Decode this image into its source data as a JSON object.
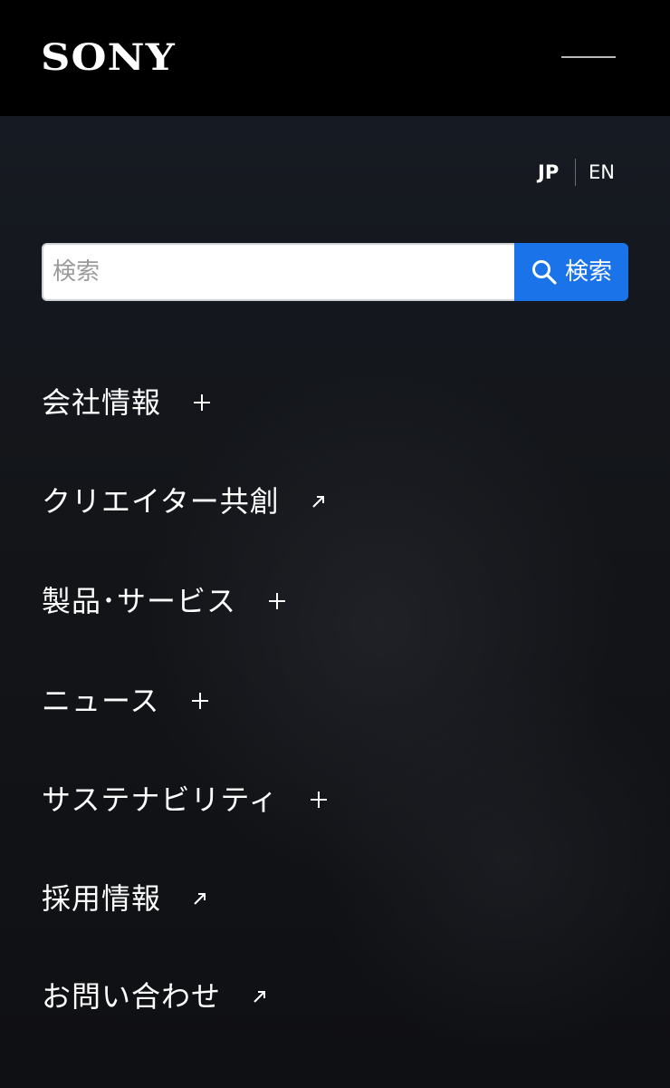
{
  "header": {
    "logo_text": "SONY",
    "menu_icon": "menu-close-line-icon"
  },
  "language": {
    "jp_label": "JP",
    "en_label": "EN",
    "selected": "JP"
  },
  "search": {
    "placeholder": "検索",
    "value": "",
    "button_label": "検索",
    "button_icon": "search-icon",
    "button_color": "#1a73e8"
  },
  "nav": {
    "items": [
      {
        "label": "会社情報",
        "icon": "plus-icon"
      },
      {
        "label": "クリエイター共創",
        "icon": "external-arrow-icon"
      },
      {
        "label": "製品･サービス",
        "icon": "plus-icon"
      },
      {
        "label": "ニュース",
        "icon": "plus-icon"
      },
      {
        "label": "サステナビリティ",
        "icon": "plus-icon"
      },
      {
        "label": "採用情報",
        "icon": "external-arrow-icon"
      },
      {
        "label": "お問い合わせ",
        "icon": "external-arrow-icon"
      }
    ]
  },
  "colors": {
    "header_bg": "#000000",
    "panel_bg": "#131519",
    "text": "#ffffff",
    "accent": "#1a73e8"
  }
}
